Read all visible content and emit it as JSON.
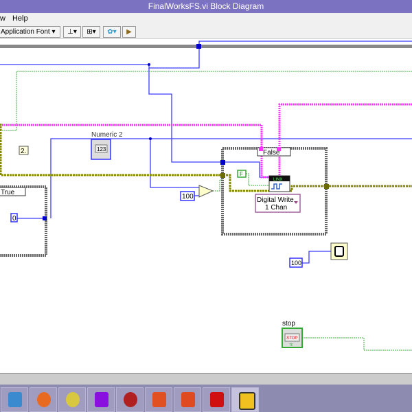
{
  "window": {
    "title": "FinalWorksFS.vi Block Diagram"
  },
  "menu": [
    "w",
    "Help"
  ],
  "toolbar": {
    "font_select": "Application Font",
    "buttons": [
      "align-objects",
      "distribute-objects",
      "reorder",
      "cleanup-diagram"
    ]
  },
  "diagram": {
    "numeric2_label": "Numeric 2",
    "numeric2_display": "123",
    "const_2": "2.",
    "const_0": "0",
    "const_100_compare": "100",
    "const_100_wait": "100",
    "case_left_selector": "True",
    "case_right_selector": "False",
    "bool_const": "F",
    "linx_label": "LINX",
    "digital_write": [
      "Digital Write",
      "1 Chan"
    ],
    "stop_label": "stop",
    "stop_button_text": "STOP",
    "stop_tf": "TF"
  },
  "colors": {
    "numeric_wire": "#3a3aff",
    "bool_wire": "#3bb33b",
    "string_wire": "#ff33ff",
    "cluster_wire": "#8a8a00",
    "titlebar": "#7c72c2"
  },
  "taskbar": [
    "network-icon",
    "firefox-icon",
    "search-tool-icon",
    "magnifier-icon",
    "mbp-icon",
    "powerpoint-icon",
    "office-icon",
    "creative-cloud-icon",
    "labview-icon"
  ]
}
